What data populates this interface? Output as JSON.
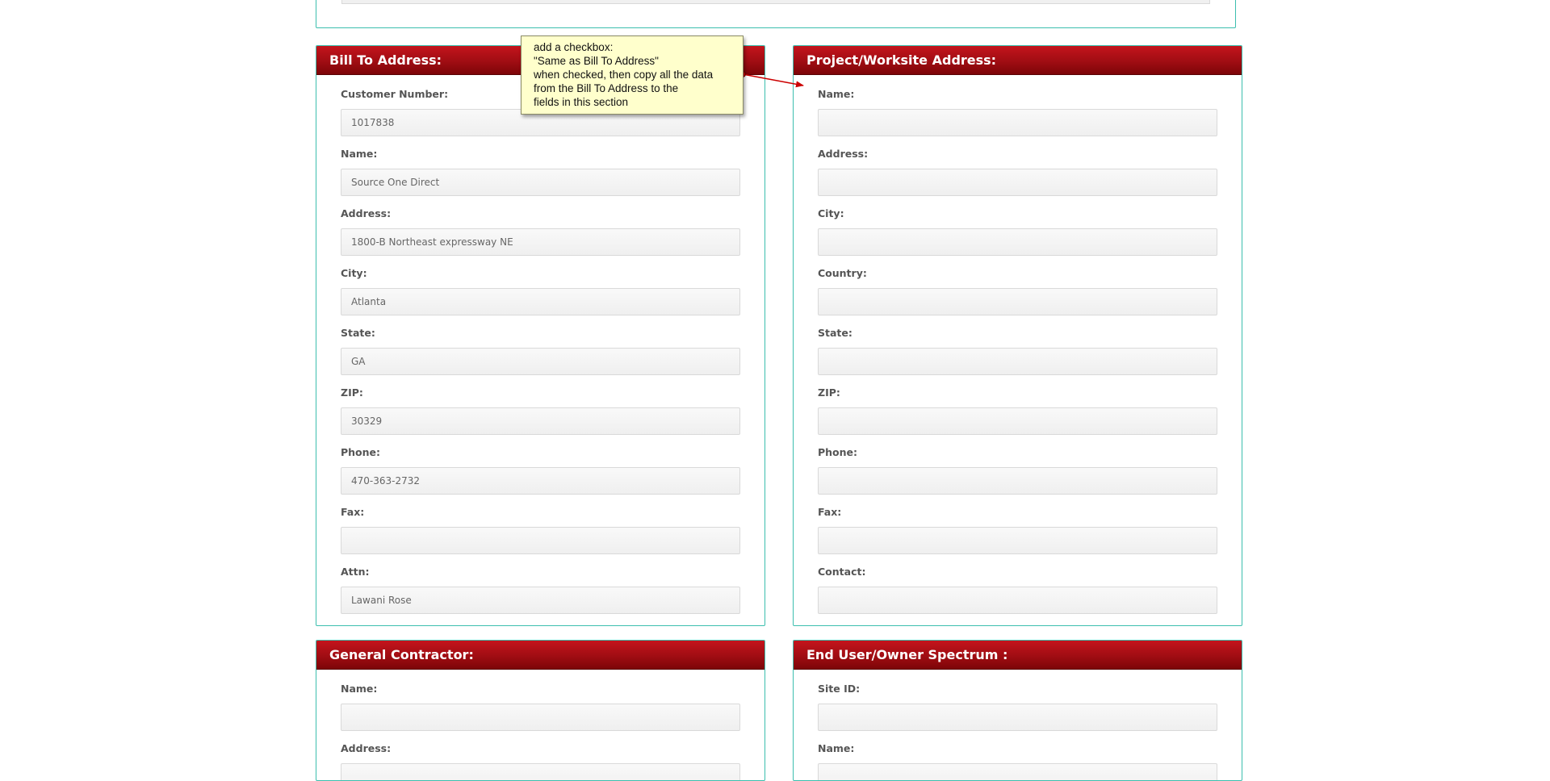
{
  "bill_to": {
    "title": "Bill To Address:",
    "fields": [
      {
        "label": "Customer Number:",
        "value": "1017838"
      },
      {
        "label": "Name:",
        "value": "Source One Direct"
      },
      {
        "label": "Address:",
        "value": "1800-B Northeast expressway NE"
      },
      {
        "label": "City:",
        "value": "Atlanta"
      },
      {
        "label": "State:",
        "value": "GA"
      },
      {
        "label": "ZIP:",
        "value": "30329"
      },
      {
        "label": "Phone:",
        "value": "470-363-2732"
      },
      {
        "label": "Fax:",
        "value": ""
      },
      {
        "label": "Attn:",
        "value": "Lawani Rose"
      }
    ]
  },
  "project": {
    "title": "Project/Worksite Address:",
    "fields": [
      {
        "label": "Name:",
        "value": ""
      },
      {
        "label": "Address:",
        "value": ""
      },
      {
        "label": "City:",
        "value": ""
      },
      {
        "label": "Country:",
        "value": ""
      },
      {
        "label": "State:",
        "value": ""
      },
      {
        "label": "ZIP:",
        "value": ""
      },
      {
        "label": "Phone:",
        "value": ""
      },
      {
        "label": "Fax:",
        "value": ""
      },
      {
        "label": "Contact:",
        "value": ""
      }
    ]
  },
  "general_contractor": {
    "title": "General Contractor:",
    "fields": [
      {
        "label": "Name:",
        "value": ""
      },
      {
        "label": "Address:",
        "value": ""
      }
    ]
  },
  "end_user": {
    "title": "End User/Owner Spectrum :",
    "fields": [
      {
        "label": "Site ID:",
        "value": ""
      },
      {
        "label": "Name:",
        "value": ""
      }
    ]
  },
  "callout": {
    "lines": [
      "add a checkbox:",
      "\"Same as Bill To Address\"",
      "when checked, then copy all the data",
      "from the Bill To Address to the",
      "fields in this section"
    ]
  },
  "colors": {
    "panel_border": "#3cbfae",
    "header_red": "#a00d13",
    "callout_bg": "#ffffcc",
    "arrow": "#cc0000"
  }
}
